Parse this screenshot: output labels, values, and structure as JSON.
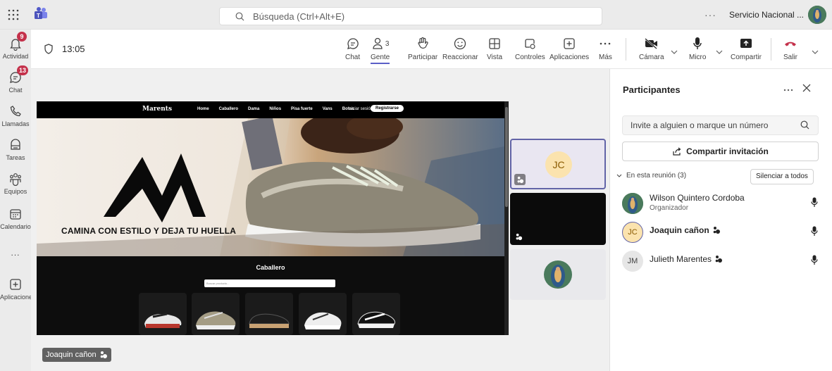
{
  "topbar": {
    "search_placeholder": "Búsqueda (Ctrl+Alt+E)",
    "more": "···",
    "org_name": "Servicio Nacional ..."
  },
  "rail": {
    "items": [
      {
        "label": "Actividad",
        "icon": "bell-icon",
        "badge": "9"
      },
      {
        "label": "Chat",
        "icon": "chat-icon",
        "badge": "13"
      },
      {
        "label": "Llamadas",
        "icon": "phone-icon",
        "badge": ""
      },
      {
        "label": "Tareas",
        "icon": "tasks-icon",
        "badge": ""
      },
      {
        "label": "Equipos",
        "icon": "teams-icon",
        "badge": ""
      },
      {
        "label": "Calendario",
        "icon": "calendar-icon",
        "badge": ""
      },
      {
        "label": "...",
        "icon": "more-icon",
        "badge": ""
      },
      {
        "label": "Aplicaciones",
        "icon": "apps-add-icon",
        "badge": ""
      }
    ]
  },
  "meeting": {
    "timer": "13:05",
    "toolbar": {
      "chat": "Chat",
      "people": "Gente",
      "people_count": "3",
      "raise": "Participar",
      "react": "Reaccionar",
      "view": "Vista",
      "controls": "Controles",
      "apps": "Aplicaciones",
      "more": "Más",
      "camera": "Cámara",
      "mic": "Micro",
      "share": "Compartir",
      "leave": "Salir"
    }
  },
  "shared_site": {
    "brand": "Marents",
    "links": [
      "Home",
      "Caballero",
      "Dama",
      "Niños",
      "Pisa fuerte",
      "Vans",
      "Botas"
    ],
    "login": "Iniciar sesión",
    "register": "Registrarse",
    "slogan": "CAMINA CON ESTILO Y DEJA TU HUELLA",
    "section_title": "Caballero",
    "search_placeholder": "Buscar producto..."
  },
  "presenter": {
    "name": "Joaquin cañon"
  },
  "tiles": {
    "jc_initials": "JC"
  },
  "panel": {
    "title": "Participantes",
    "invite_placeholder": "Invite a alguien o marque un número",
    "share_invite": "Compartir invitación",
    "in_meeting": "En esta reunión (3)",
    "mute_all": "Silenciar a todos",
    "people": [
      {
        "name": "Wilson Quintero Cordoba",
        "role": "Organizador",
        "initials": ""
      },
      {
        "name": "Joaquin cañon",
        "role": "",
        "initials": "JC"
      },
      {
        "name": "Julieth Marentes",
        "role": "",
        "initials": "JM"
      }
    ]
  },
  "colors": {
    "accent": "#5b5fc7",
    "leave": "#c4314b",
    "badge": "#c4314b"
  }
}
